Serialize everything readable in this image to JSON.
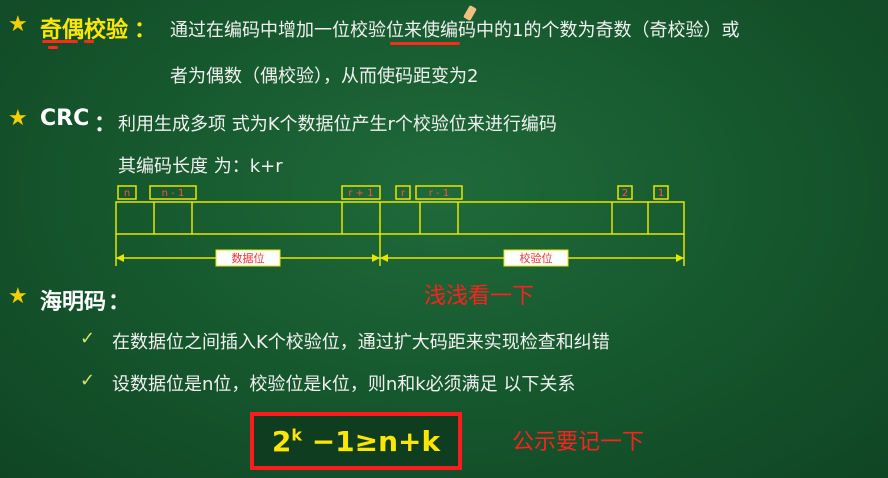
{
  "parity": {
    "title": "奇偶校验",
    "colon": "：",
    "line1": "通过在编码中增加一位校验位来使编码中的1的个数为奇数（奇校验）或",
    "line2": "者为偶数（偶校验），从而使码距变为2"
  },
  "crc": {
    "title": "CRC",
    "colon": "：",
    "line1": "利用生成多项 式为K个数据位产生r个校验位来进行编码",
    "line2": "其编码长度 为：k+r",
    "diagram": {
      "cell_labels": [
        "n",
        "n - 1",
        "r + 1",
        "r",
        "r - 1",
        "2",
        "1"
      ],
      "data_label": "数据位",
      "check_label": "校验位"
    }
  },
  "hamming": {
    "title": "海明码",
    "colon": "：",
    "bullet1": "在数据位之间插入K个校验位，通过扩大码距来实现检查和纠错",
    "bullet2": "设数据位是n位，校验位是k位，则n和k必须满足 以下关系",
    "formula_base": "2",
    "formula_exp": "k",
    "formula_rest": " −1≥n+k"
  },
  "notes": {
    "glance": "浅浅看一下",
    "remember": "公示要记一下"
  },
  "colors": {
    "background": "#175a2f",
    "star": "#f5d000",
    "highlight": "#ffe600",
    "annotation": "#ff2020"
  }
}
